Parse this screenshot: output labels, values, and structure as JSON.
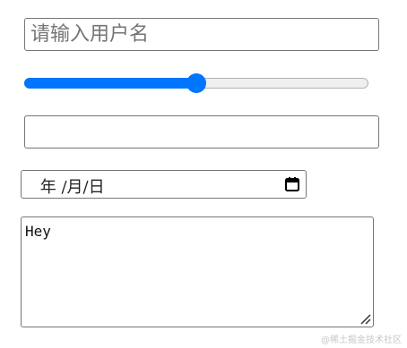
{
  "username_input": {
    "value": "",
    "placeholder": "请输入用户名"
  },
  "range_slider": {
    "min": 0,
    "max": 100,
    "value": 50
  },
  "text_field": {
    "value": ""
  },
  "date_input": {
    "display": " 年 /月/日",
    "icon": "calendar-icon"
  },
  "textarea": {
    "value": "Hey",
    "resize_icon": "resize-handle-icon"
  },
  "watermark": {
    "text": "@稀土掘金技术社区"
  },
  "colors": {
    "accent": "#0075ff",
    "border": "#767676",
    "track": "#efefef",
    "placeholder": "#757575"
  }
}
